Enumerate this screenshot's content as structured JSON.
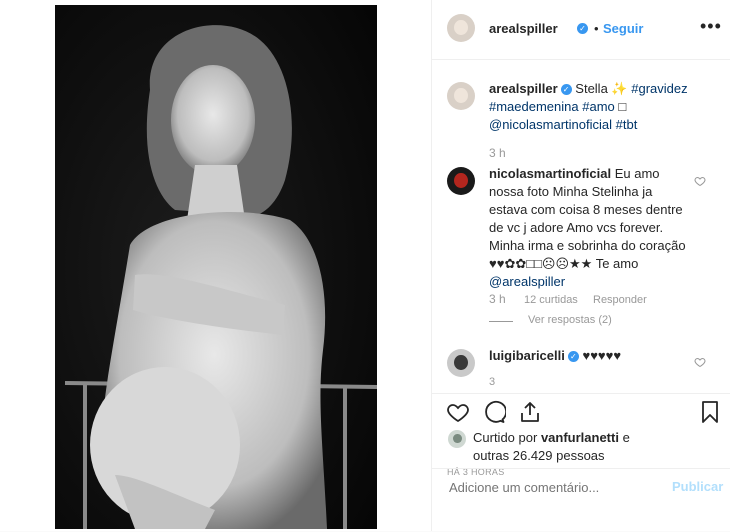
{
  "header": {
    "username": "arealspiller",
    "separator": "•",
    "follow_label": "Seguir",
    "more_icon": "more-horizontal-icon"
  },
  "caption": {
    "username": "arealspiller",
    "text_plain": "Stella ✨",
    "tags": [
      "#gravidez",
      "#maedemenina",
      "#amo"
    ],
    "emoji": "□",
    "mention": "@nicolasmartinoficial",
    "tag_last": "#tbt",
    "time": "3 h"
  },
  "comments": [
    {
      "username": "nicolasmartinoficial",
      "text": "Eu amo nossa foto Minha Stelinha ja estava com coisa 8 meses dentre de vc j adore Amo vcs forever. Minha irma e sobrinha do coração ♥♥✿✿□□☹☹★★ Te amo",
      "mention": "@arealspiller",
      "time": "3 h",
      "likes": "12 curtidas",
      "reply": "Responder",
      "view_replies": "Ver respostas (2)"
    },
    {
      "username": "luigibaricelli",
      "text": "♥♥♥♥♥"
    }
  ],
  "likes": {
    "prefix": "Curtido por",
    "user": "vanfurlanetti",
    "middle": "e",
    "others": "outras 26.429 pessoas"
  },
  "timestamp": "HÁ 3 HORAS",
  "add_comment": {
    "placeholder": "Adicione um comentário...",
    "publish_label": "Publicar"
  },
  "colors": {
    "accent": "#3897f0",
    "link": "#003569",
    "muted": "#999999",
    "text": "#262626"
  }
}
